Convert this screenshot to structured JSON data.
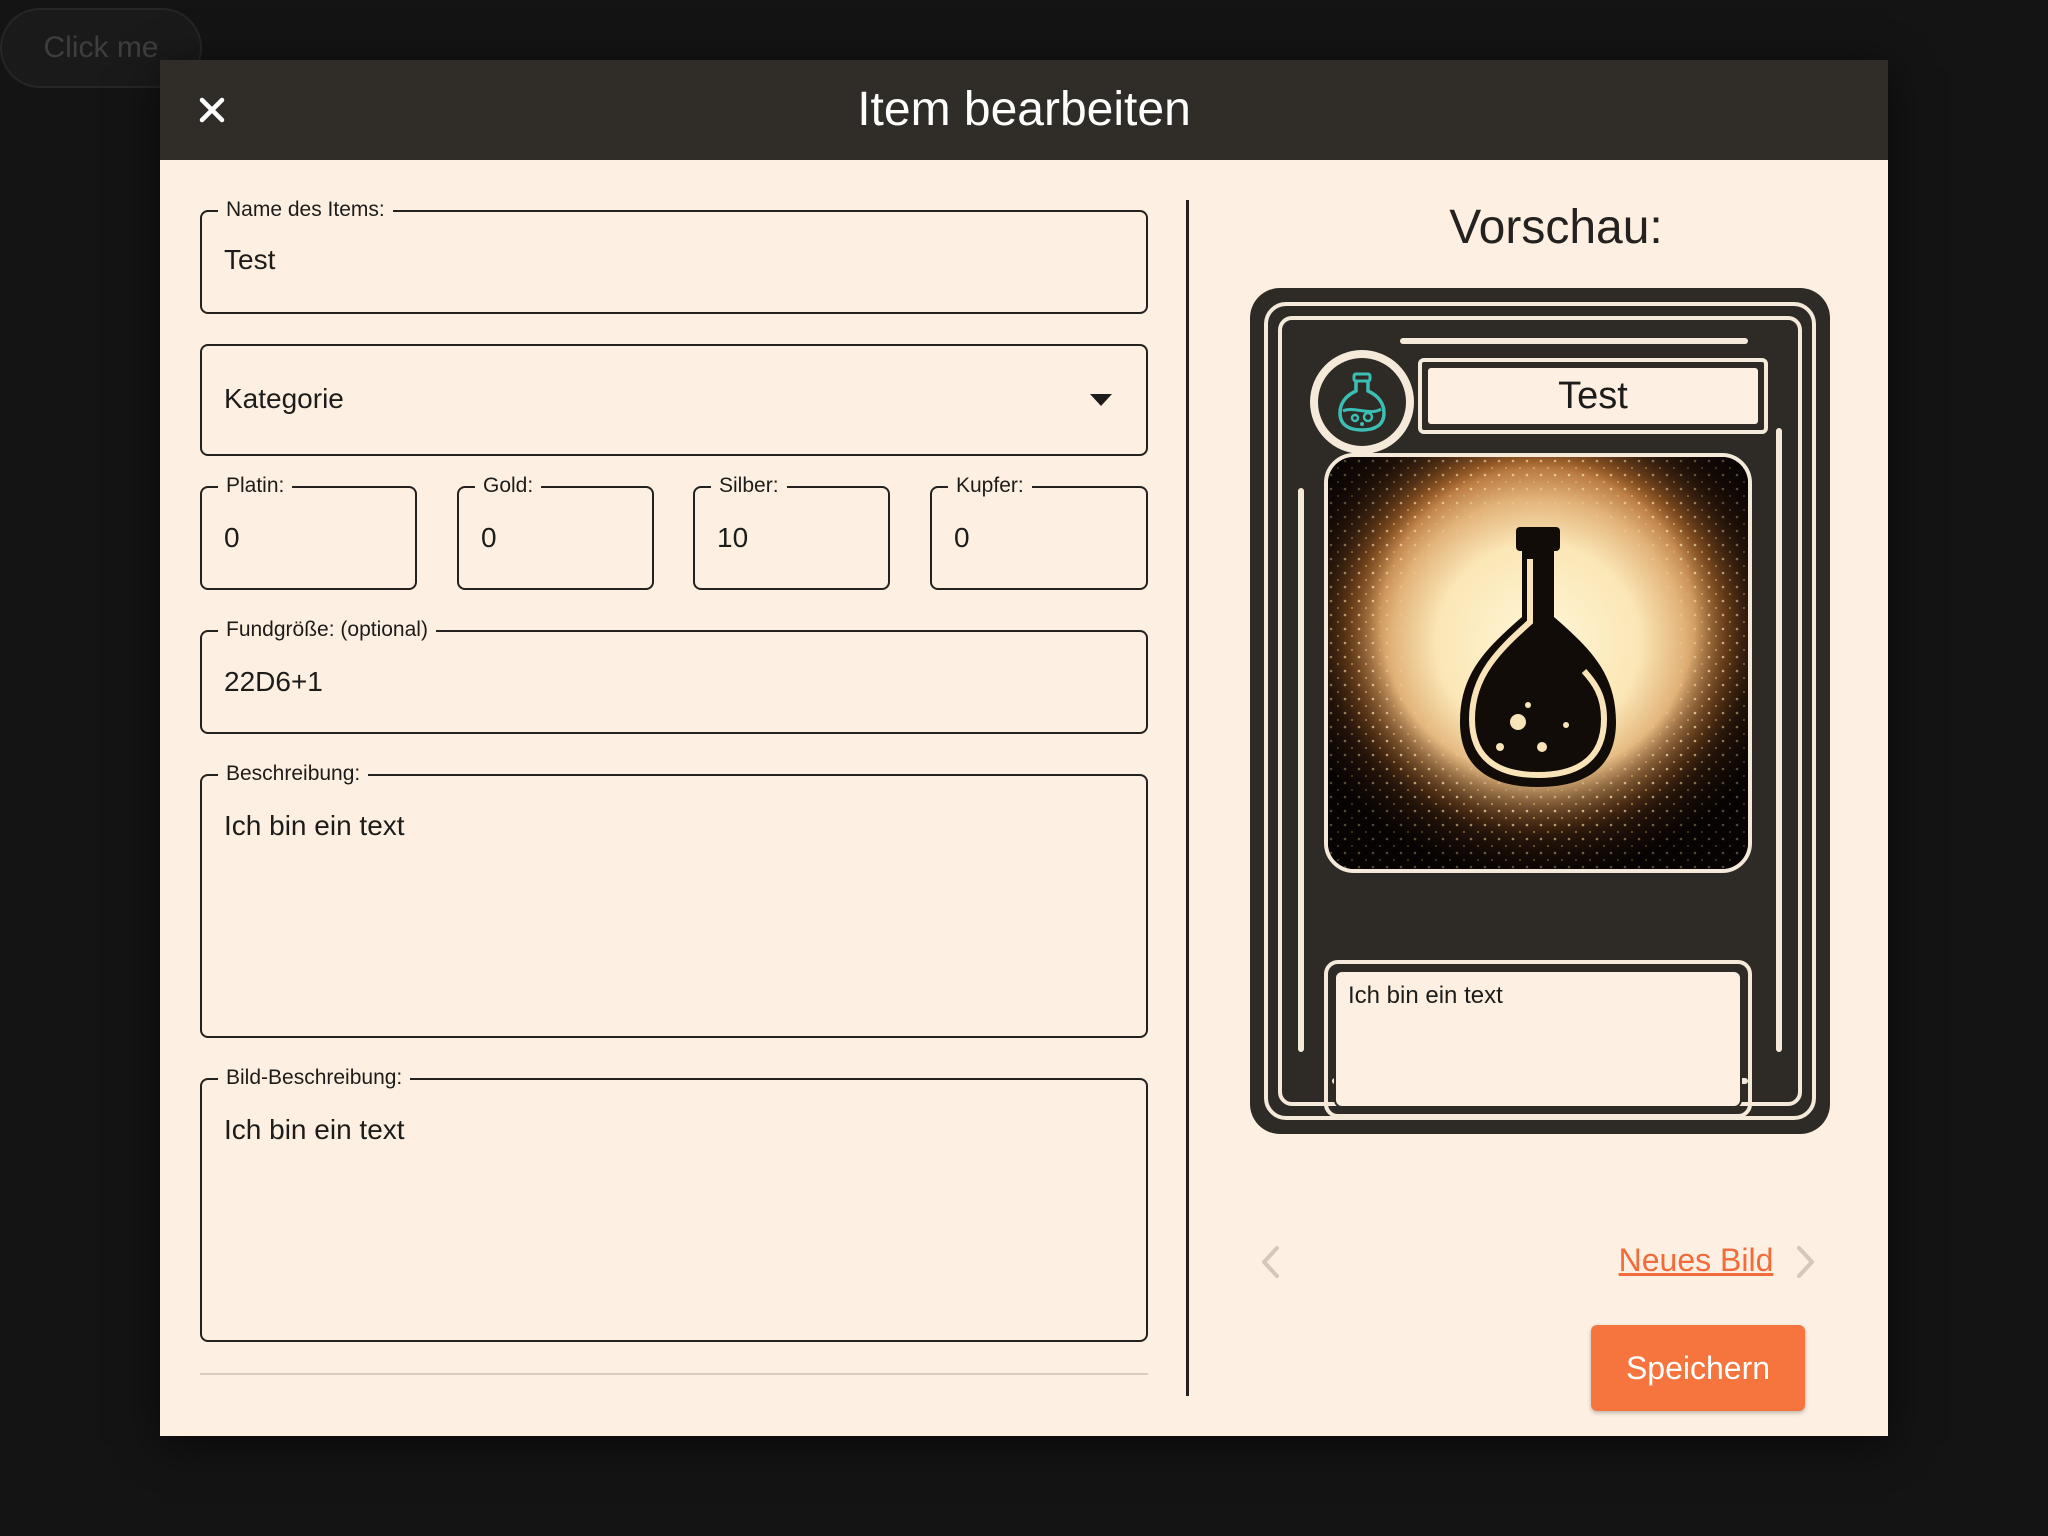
{
  "background": {
    "button_label": "Click me"
  },
  "modal": {
    "title": "Item bearbeiten",
    "close_icon": "close-icon"
  },
  "form": {
    "name": {
      "label": "Name des Items:",
      "value": "Test"
    },
    "category": {
      "placeholder": "Kategorie"
    },
    "platin": {
      "label": "Platin:",
      "value": "0"
    },
    "gold": {
      "label": "Gold:",
      "value": "0"
    },
    "silber": {
      "label": "Silber:",
      "value": "10"
    },
    "kupfer": {
      "label": "Kupfer:",
      "value": "0"
    },
    "fundgroesse": {
      "label": "Fundgröße: (optional)",
      "value": "22D6+1"
    },
    "beschreibung": {
      "label": "Beschreibung:",
      "value": "Ich bin ein text"
    },
    "bild_beschreibung": {
      "label": "Bild-Beschreibung:",
      "value": "Ich bin ein text"
    }
  },
  "preview": {
    "heading": "Vorschau:",
    "card": {
      "title": "Test",
      "emblem_icon": "potion-icon",
      "image_icon": "potion-bottle-illustration",
      "description": "Ich bin ein text"
    },
    "new_image_label": "Neues Bild",
    "prev_icon": "chevron-left-icon",
    "next_icon": "chevron-right-icon",
    "save_label": "Speichern"
  },
  "colors": {
    "header_bg": "#302c27",
    "modal_bg": "#fdf0e2",
    "accent": "#f6753e",
    "card_bg": "#2e2b27",
    "emblem_teal": "#3bbfb5"
  }
}
